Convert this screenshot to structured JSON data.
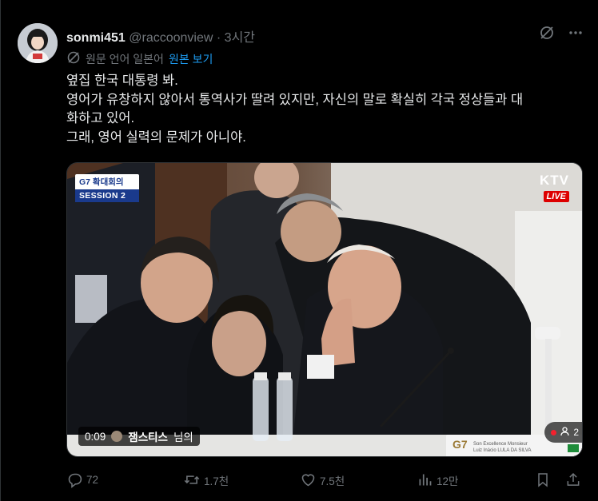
{
  "post": {
    "author_name": "sonmi451",
    "author_handle": "@raccoonview",
    "separator": "·",
    "time_ago": "3시간",
    "translation": {
      "source_language_text": "원문 언어 일본어",
      "show_original_label": "원본 보기"
    },
    "text_lines": [
      "옆집 한국 대통령 봐.",
      "영어가 유창하지 않아서 통역사가 딸려 있지만, 자신의 말로 확실히 각국 정상들과 대",
      "화하고 있어.",
      "그래, 영어 실력의 문제가 아니야."
    ]
  },
  "media": {
    "overlay_top_label": "G7 확대회의",
    "overlay_session": "SESSION 2",
    "broadcaster": "KTV",
    "live_label": "LIVE",
    "timestamp": "0:09",
    "space_host_name": "잼스티스",
    "space_host_suffix": "님의",
    "viewer_count": "2",
    "nameplate": {
      "logo": "G7",
      "line1": "Son Excellence Monsieur",
      "line2": "Luiz Inácio LULA DA SILVA"
    }
  },
  "actions": {
    "replies": "72",
    "reposts": "1.7천",
    "likes": "7.5천",
    "views": "12만"
  },
  "icons": {
    "translate": "translate-icon",
    "more": "more-icon",
    "grok": "grok-icon",
    "reply": "reply-icon",
    "repost": "repost-icon",
    "like": "heart-icon",
    "views": "views-icon",
    "bookmark": "bookmark-icon",
    "share": "share-icon"
  },
  "colors": {
    "background": "#000000",
    "text": "#e7e9ea",
    "muted": "#71767b",
    "link": "#1d9bf0",
    "live": "#dd0000"
  }
}
